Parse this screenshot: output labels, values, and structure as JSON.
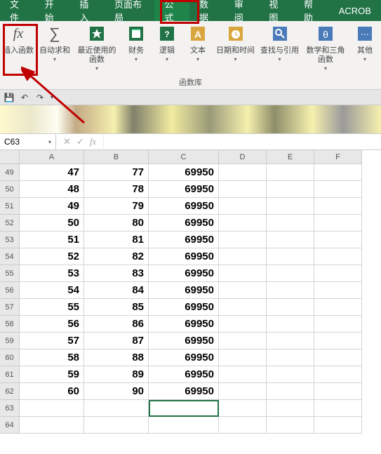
{
  "tabs": {
    "items": [
      "文件",
      "开始",
      "插入",
      "页面布局",
      "公式",
      "数据",
      "审阅",
      "视图",
      "帮助",
      "ACROB"
    ],
    "activeIndex": 4
  },
  "ribbon": {
    "items": [
      {
        "name": "insert-function",
        "label": "插入函数",
        "icon": "fx",
        "drop": false
      },
      {
        "name": "autosum",
        "label": "自动求和",
        "icon": "sigma",
        "drop": true
      },
      {
        "name": "recent",
        "label": "最近使用的函数",
        "icon": "star",
        "drop": true
      },
      {
        "name": "financial",
        "label": "财务",
        "icon": "money",
        "drop": true
      },
      {
        "name": "logical",
        "label": "逻辑",
        "icon": "logic",
        "drop": true
      },
      {
        "name": "text",
        "label": "文本",
        "icon": "text",
        "drop": true
      },
      {
        "name": "datetime",
        "label": "日期和时间",
        "icon": "clock",
        "drop": true
      },
      {
        "name": "lookup",
        "label": "查找与引用",
        "icon": "lookup",
        "drop": true
      },
      {
        "name": "math",
        "label": "数学和三角函数",
        "icon": "theta",
        "drop": true
      },
      {
        "name": "more",
        "label": "其他",
        "icon": "more",
        "drop": true
      }
    ],
    "groupLabel": "函数库"
  },
  "qat": {
    "save": "💾",
    "undo": "↶",
    "redo": "↷"
  },
  "namebox": {
    "value": "C63"
  },
  "formulabar": {
    "fx": "fx",
    "value": ""
  },
  "grid": {
    "cols": [
      "A",
      "B",
      "C",
      "D",
      "E",
      "F"
    ],
    "startRow": 49,
    "rows": [
      {
        "r": 49,
        "A": "47",
        "B": "77",
        "C": "69950"
      },
      {
        "r": 50,
        "A": "48",
        "B": "78",
        "C": "69950"
      },
      {
        "r": 51,
        "A": "49",
        "B": "79",
        "C": "69950"
      },
      {
        "r": 52,
        "A": "50",
        "B": "80",
        "C": "69950"
      },
      {
        "r": 53,
        "A": "51",
        "B": "81",
        "C": "69950"
      },
      {
        "r": 54,
        "A": "52",
        "B": "82",
        "C": "69950"
      },
      {
        "r": 55,
        "A": "53",
        "B": "83",
        "C": "69950"
      },
      {
        "r": 56,
        "A": "54",
        "B": "84",
        "C": "69950"
      },
      {
        "r": 57,
        "A": "55",
        "B": "85",
        "C": "69950"
      },
      {
        "r": 58,
        "A": "56",
        "B": "86",
        "C": "69950"
      },
      {
        "r": 59,
        "A": "57",
        "B": "87",
        "C": "69950"
      },
      {
        "r": 60,
        "A": "58",
        "B": "88",
        "C": "69950"
      },
      {
        "r": 61,
        "A": "59",
        "B": "89",
        "C": "69950"
      },
      {
        "r": 62,
        "A": "60",
        "B": "90",
        "C": "69950"
      },
      {
        "r": 63,
        "A": "",
        "B": "",
        "C": ""
      },
      {
        "r": 64,
        "A": "",
        "B": "",
        "C": ""
      }
    ],
    "selected": {
      "col": "C",
      "row": 63
    }
  }
}
